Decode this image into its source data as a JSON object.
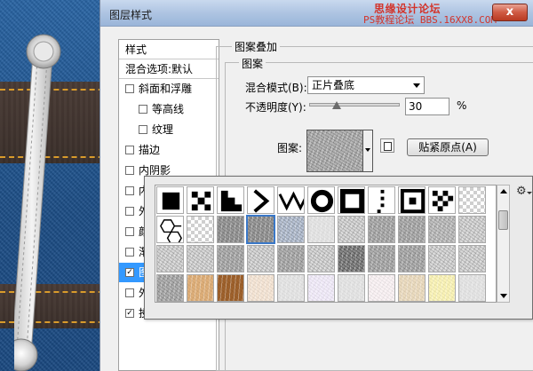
{
  "dialog": {
    "title": "图层样式",
    "watermark": {
      "line1": "思缘设计论坛",
      "line2": "PS教程论坛",
      "line3": "BBS.16XX8.COM"
    },
    "close_label": "x"
  },
  "styles_panel": {
    "header": "样式",
    "blend_options": "混合选项:默认",
    "items": [
      {
        "label": "斜面和浮雕",
        "checked": false
      },
      {
        "label": "等高线",
        "checked": false
      },
      {
        "label": "纹理",
        "checked": false
      },
      {
        "label": "描边",
        "checked": false
      },
      {
        "label": "内阴影",
        "checked": false
      },
      {
        "label": "内",
        "checked": false
      },
      {
        "label": "外",
        "checked": false
      },
      {
        "label": "颜",
        "checked": false
      },
      {
        "label": "渐",
        "checked": false
      },
      {
        "label": "图",
        "checked": true
      },
      {
        "label": "外",
        "checked": false
      },
      {
        "label": "投",
        "checked": true
      }
    ]
  },
  "pattern_overlay": {
    "section_title": "图案叠加",
    "group_title": "图案",
    "blend_mode_label": "混合模式(B):",
    "blend_mode_value": "正片叠底",
    "opacity_label": "不透明度(Y):",
    "opacity_value": "30",
    "opacity_percent": 30,
    "opacity_unit": "%",
    "pattern_label": "图案:",
    "snap_button": "贴紧原点(A)"
  },
  "pattern_picker": {
    "selected_index": 14,
    "scroll_position": 0.15,
    "tiles": [
      "black-square",
      "x-pattern",
      "staircase",
      "chevrons",
      "zigzag",
      "ring",
      "square-ring",
      "dots-column",
      "square-target",
      "checker-diamond",
      "transparent",
      "hexagons",
      "transparent",
      "noise-gray",
      "noise-gray",
      "noise-blue",
      "light-gray",
      "light-noise",
      "gray-noise",
      "gray-noise",
      "gray-grid",
      "light-noise",
      "light-noise",
      "light-noise",
      "gray-noise",
      "light-noise",
      "gray-noise",
      "light-noise",
      "dark-noise",
      "gray-noise",
      "gray-noise",
      "light-noise",
      "light-noise",
      "gray-noise",
      "tan",
      "brown",
      "light-peach",
      "light-gray",
      "lavender",
      "light-gray",
      "pink-white",
      "light-beige",
      "light-yellow",
      "light-gray"
    ],
    "colors": {
      "light-peach": "#f6e6d6",
      "tan": "#e0b07a",
      "brown": "#a0622c",
      "lavender": "#f2ecfa",
      "pink-white": "#faf2f4",
      "light-beige": "#ecdcc0",
      "light-yellow": "#fbf4b8"
    }
  },
  "icons": {
    "gear": "gear-icon",
    "new_preset": "new-preset-icon"
  }
}
